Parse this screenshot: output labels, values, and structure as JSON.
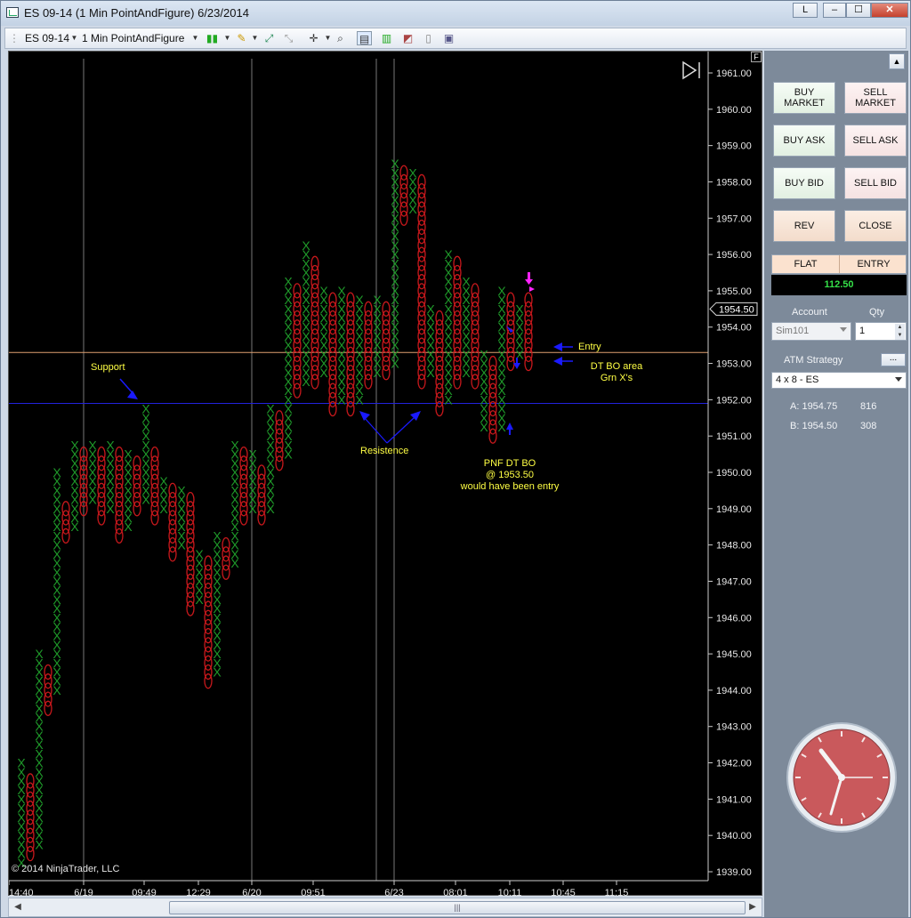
{
  "window": {
    "title": "ES 09-14 (1 Min PointAndFigure)  6/23/2014",
    "btn_l": "L",
    "btn_min": "‒",
    "btn_max": "☐",
    "btn_close": "✕"
  },
  "toolbar": {
    "instrument": "ES 09-14",
    "period": "1 Min PointAndFigure"
  },
  "chart": {
    "copyright": "© 2014 NinjaTrader, LLC",
    "f_button": "F",
    "price_min": 1939,
    "price_max": 1961,
    "y_ticks": [
      "1961.00",
      "1960.00",
      "1959.00",
      "1958.00",
      "1957.00",
      "1956.00",
      "1955.00",
      "1954.00",
      "1953.00",
      "1952.00",
      "1951.00",
      "1950.00",
      "1949.00",
      "1948.00",
      "1947.00",
      "1946.00",
      "1945.00",
      "1944.00",
      "1943.00",
      "1942.00",
      "1941.00",
      "1940.00",
      "1939.00"
    ],
    "last_price_label": "1954.50",
    "x_ticks": [
      "14:40",
      "6/19",
      "09:49",
      "12:29",
      "6/20",
      "09:51",
      "6/23",
      "08:01",
      "10:11",
      "10:45",
      "11:15"
    ],
    "support_level": 1951.9,
    "entry_level": 1953.3,
    "colors": {
      "x": "#1f9a2a",
      "o": "#c8181c",
      "annot": "#ffff44",
      "arrow": "#1a1aff",
      "magenta": "#ff22ff",
      "support_line": "#2222dd",
      "entry_line": "#e0a070"
    },
    "annotations": {
      "support": "Support",
      "resistance": "Resistence",
      "entry": "Entry",
      "dtbo1": "DT BO area",
      "dtbo2": "Grn X's",
      "pnf1": "PNF DT BO",
      "pnf2": "@ 1953.50",
      "pnf3": "would have been entry"
    }
  },
  "chart_data": {
    "type": "scatter",
    "box_size": 0.25,
    "y_range": [
      1939,
      1961
    ],
    "columns": [
      {
        "t": "X",
        "lo": 1939.25,
        "hi": 1942.0
      },
      {
        "t": "O",
        "lo": 1939.5,
        "hi": 1941.5
      },
      {
        "t": "X",
        "lo": 1939.75,
        "hi": 1945.0
      },
      {
        "t": "O",
        "lo": 1943.5,
        "hi": 1944.5
      },
      {
        "t": "X",
        "lo": 1944.0,
        "hi": 1950.0
      },
      {
        "t": "O",
        "lo": 1948.25,
        "hi": 1949.0
      },
      {
        "t": "X",
        "lo": 1948.5,
        "hi": 1950.75
      },
      {
        "t": "O",
        "lo": 1949.0,
        "hi": 1950.5
      },
      {
        "t": "X",
        "lo": 1949.25,
        "hi": 1950.75
      },
      {
        "t": "O",
        "lo": 1948.75,
        "hi": 1950.5
      },
      {
        "t": "X",
        "lo": 1949.0,
        "hi": 1950.75
      },
      {
        "t": "O",
        "lo": 1948.25,
        "hi": 1950.5
      },
      {
        "t": "X",
        "lo": 1948.5,
        "hi": 1950.5
      },
      {
        "t": "O",
        "lo": 1949.0,
        "hi": 1950.25
      },
      {
        "t": "X",
        "lo": 1949.25,
        "hi": 1951.75
      },
      {
        "t": "O",
        "lo": 1948.75,
        "hi": 1950.5
      },
      {
        "t": "X",
        "lo": 1949.0,
        "hi": 1949.75
      },
      {
        "t": "O",
        "lo": 1947.75,
        "hi": 1949.5
      },
      {
        "t": "X",
        "lo": 1948.0,
        "hi": 1949.5
      },
      {
        "t": "O",
        "lo": 1946.25,
        "hi": 1949.25
      },
      {
        "t": "X",
        "lo": 1946.5,
        "hi": 1947.75
      },
      {
        "t": "O",
        "lo": 1944.25,
        "hi": 1947.5
      },
      {
        "t": "X",
        "lo": 1944.5,
        "hi": 1948.25
      },
      {
        "t": "O",
        "lo": 1947.25,
        "hi": 1948.0
      },
      {
        "t": "X",
        "lo": 1947.5,
        "hi": 1950.75
      },
      {
        "t": "O",
        "lo": 1948.75,
        "hi": 1950.5
      },
      {
        "t": "X",
        "lo": 1949.0,
        "hi": 1950.5
      },
      {
        "t": "O",
        "lo": 1948.75,
        "hi": 1950.0
      },
      {
        "t": "X",
        "lo": 1949.0,
        "hi": 1951.75
      },
      {
        "t": "O",
        "lo": 1950.25,
        "hi": 1951.5
      },
      {
        "t": "X",
        "lo": 1950.5,
        "hi": 1955.25
      },
      {
        "t": "O",
        "lo": 1952.25,
        "hi": 1955.0
      },
      {
        "t": "X",
        "lo": 1952.5,
        "hi": 1956.25
      },
      {
        "t": "O",
        "lo": 1952.5,
        "hi": 1955.75
      },
      {
        "t": "X",
        "lo": 1952.75,
        "hi": 1955.0
      },
      {
        "t": "O",
        "lo": 1951.75,
        "hi": 1954.75
      },
      {
        "t": "X",
        "lo": 1952.0,
        "hi": 1955.0
      },
      {
        "t": "O",
        "lo": 1951.75,
        "hi": 1954.75
      },
      {
        "t": "X",
        "lo": 1952.0,
        "hi": 1954.75
      },
      {
        "t": "O",
        "lo": 1952.5,
        "hi": 1954.5
      },
      {
        "t": "X",
        "lo": 1952.75,
        "hi": 1954.75
      },
      {
        "t": "O",
        "lo": 1952.75,
        "hi": 1954.5
      },
      {
        "t": "X",
        "lo": 1953.0,
        "hi": 1958.5
      },
      {
        "t": "O",
        "lo": 1957.0,
        "hi": 1958.25
      },
      {
        "t": "X",
        "lo": 1957.25,
        "hi": 1958.25
      },
      {
        "t": "O",
        "lo": 1952.5,
        "hi": 1958.0
      },
      {
        "t": "X",
        "lo": 1952.75,
        "hi": 1954.5
      },
      {
        "t": "O",
        "lo": 1951.75,
        "hi": 1954.25
      },
      {
        "t": "X",
        "lo": 1952.0,
        "hi": 1956.0
      },
      {
        "t": "O",
        "lo": 1952.5,
        "hi": 1955.75
      },
      {
        "t": "X",
        "lo": 1952.75,
        "hi": 1955.25
      },
      {
        "t": "O",
        "lo": 1952.5,
        "hi": 1955.0
      },
      {
        "t": "X",
        "lo": 1951.25,
        "hi": 1953.25
      },
      {
        "t": "O",
        "lo": 1951.0,
        "hi": 1953.0
      },
      {
        "t": "X",
        "lo": 1951.25,
        "hi": 1955.0
      },
      {
        "t": "O",
        "lo": 1953.0,
        "hi": 1954.75
      },
      {
        "t": "X",
        "lo": 1953.25,
        "hi": 1954.5
      },
      {
        "t": "O",
        "lo": 1953.0,
        "hi": 1954.75
      }
    ]
  },
  "panel": {
    "buy_market": "BUY\nMARKET",
    "sell_market": "SELL\nMARKET",
    "buy_ask": "BUY ASK",
    "sell_ask": "SELL ASK",
    "buy_bid": "BUY BID",
    "sell_bid": "SELL BID",
    "rev": "REV",
    "close": "CLOSE",
    "flat": "FLAT",
    "entry": "ENTRY",
    "pnl": "112.50",
    "account_label": "Account",
    "qty_label": "Qty",
    "account_value": "Sim101",
    "qty_value": "1",
    "atm_label": "ATM Strategy",
    "atm_btn": "...",
    "atm_value": "4 x 8 - ES",
    "ask_label": "A: 1954.75",
    "ask_size": "816",
    "bid_label": "B: 1954.50",
    "bid_size": "308"
  }
}
